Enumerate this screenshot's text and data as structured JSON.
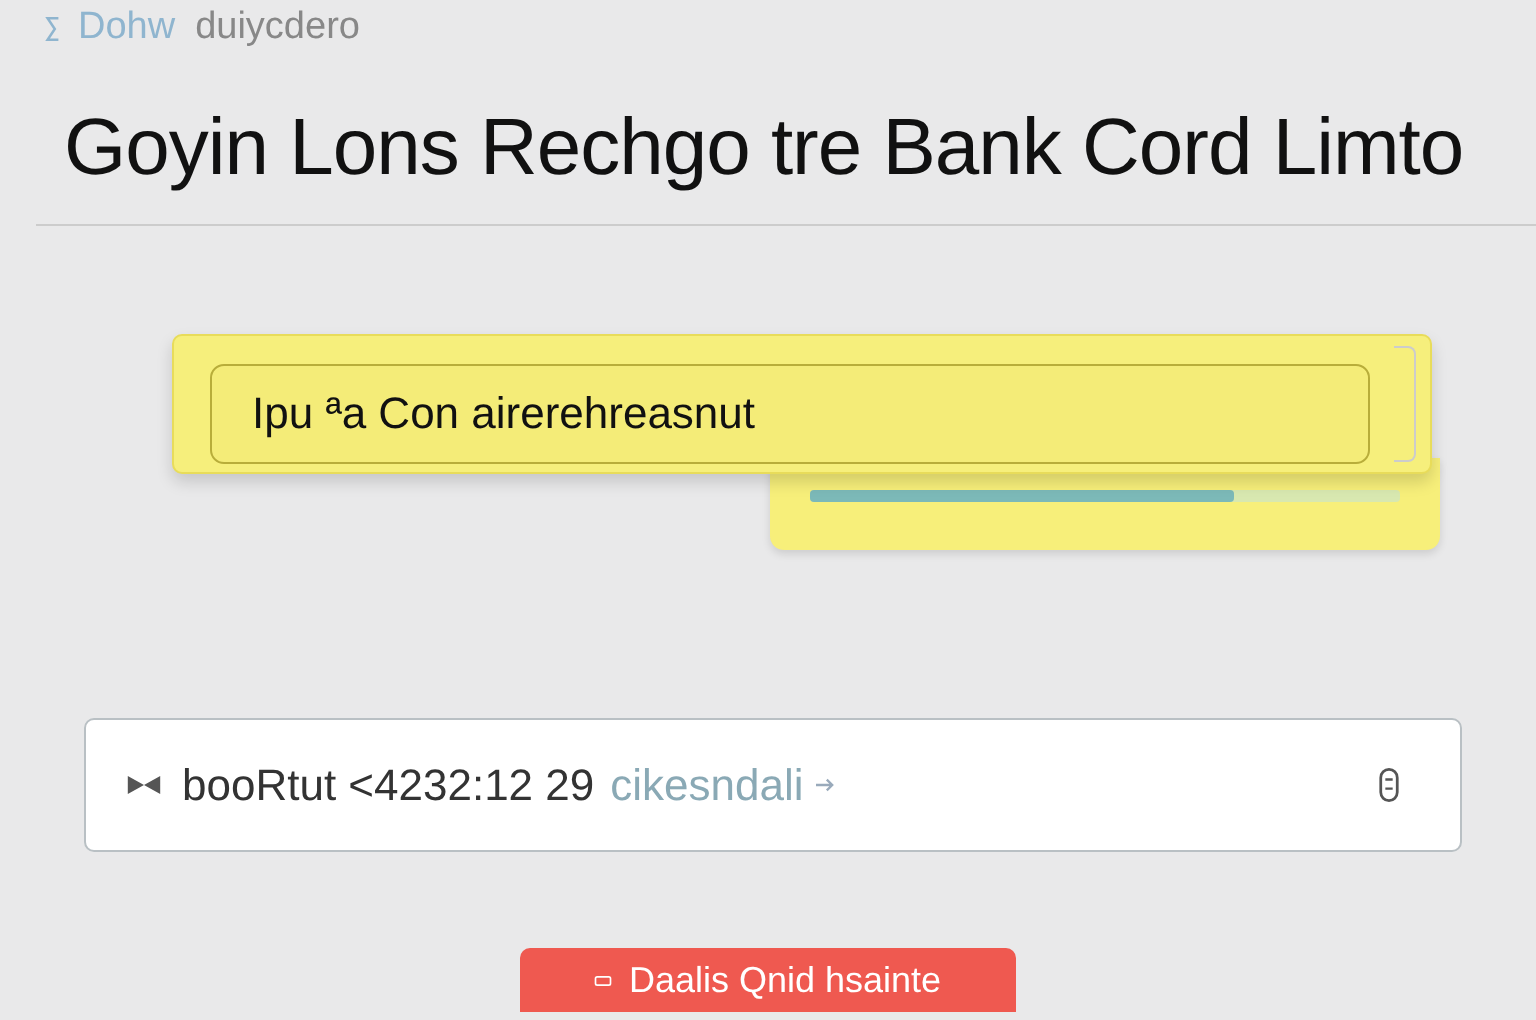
{
  "breadcrumb": {
    "section": "Dohw",
    "page": "duiycdero"
  },
  "title": "Goyin Lons Rechgo tre Bank Cord Limto",
  "notice": {
    "text": "Ipu ªa Con airerehreasnut",
    "progress": {
      "level": 0.72
    }
  },
  "card_field": {
    "value": "booRtut <4232:12 29",
    "hint": "cikesndali"
  },
  "button": {
    "label": "Daalis Qnid hsainte"
  }
}
